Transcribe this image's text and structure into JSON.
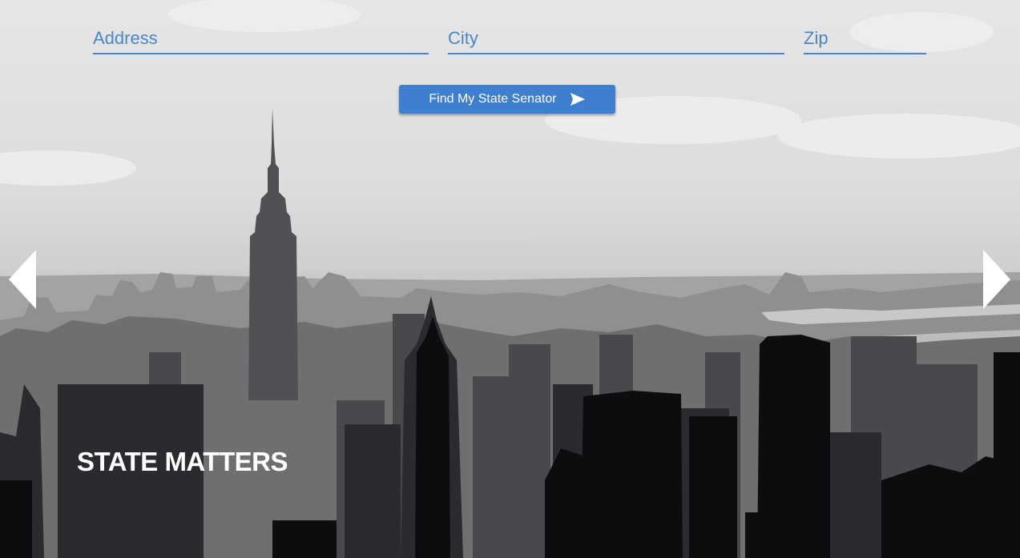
{
  "form": {
    "address_placeholder": "Address",
    "city_placeholder": "City",
    "zip_placeholder": "Zip",
    "submit_label": "Find My State Senator",
    "submit_icon": "send-icon"
  },
  "carousel": {
    "prev_icon": "chevron-left-icon",
    "next_icon": "chevron-right-icon",
    "slide_title": "STATE MATTERS"
  },
  "colors": {
    "accent": "#4a86c8",
    "button": "#3f7fcf",
    "text_light": "#ffffff"
  }
}
